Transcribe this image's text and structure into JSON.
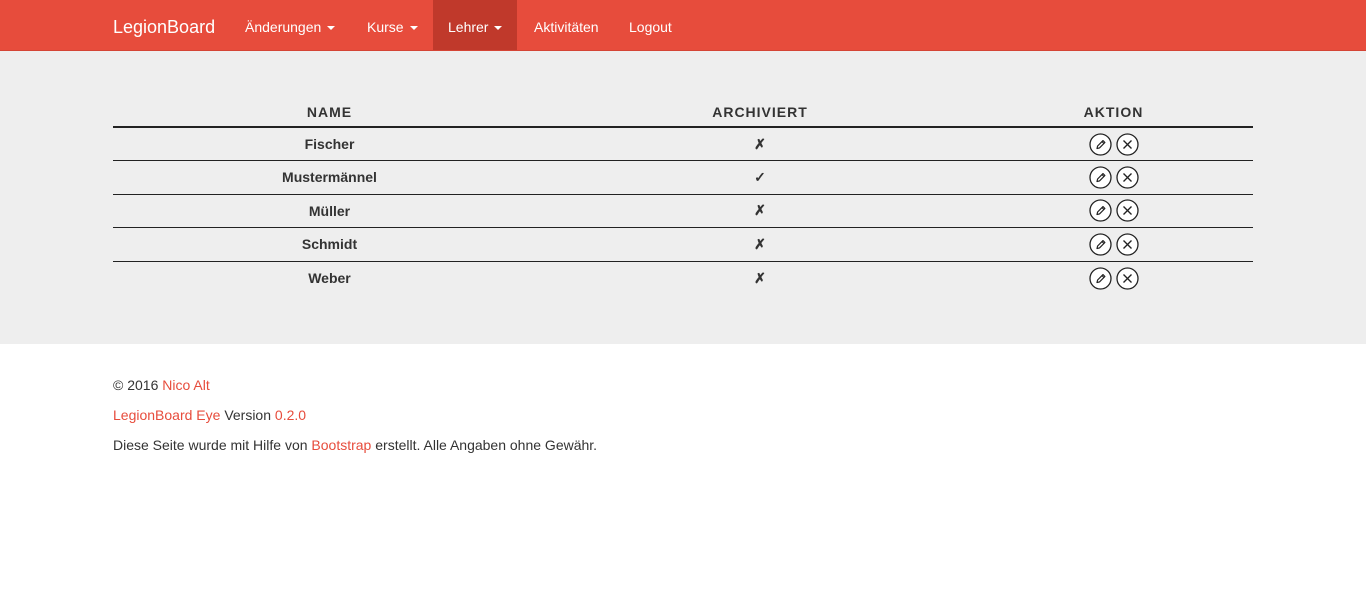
{
  "navbar": {
    "brand": "LegionBoard",
    "items": [
      {
        "label": "Änderungen",
        "dropdown": true,
        "active": false
      },
      {
        "label": "Kurse",
        "dropdown": true,
        "active": false
      },
      {
        "label": "Lehrer",
        "dropdown": true,
        "active": true
      },
      {
        "label": "Aktivitäten",
        "dropdown": false,
        "active": false
      },
      {
        "label": "Logout",
        "dropdown": false,
        "active": false
      }
    ]
  },
  "table": {
    "headers": {
      "name": "Name",
      "archived": "Archiviert",
      "action": "Aktion"
    },
    "rows": [
      {
        "name": "Fischer",
        "archived": "✗"
      },
      {
        "name": "Mustermännel",
        "archived": "✓"
      },
      {
        "name": "Müller",
        "archived": "✗"
      },
      {
        "name": "Schmidt",
        "archived": "✗"
      },
      {
        "name": "Weber",
        "archived": "✗"
      }
    ],
    "action_icons": [
      "pencil-icon",
      "close-circle-icon"
    ]
  },
  "footer": {
    "copyright_prefix": "© 2016",
    "author_link": "Nico Alt",
    "app_link": "LegionBoard Eye",
    "version_text": "Version",
    "version_link": "0.2.0",
    "credits_prefix": "Diese Seite wurde mit Hilfe von",
    "credits_link": "Bootstrap",
    "credits_suffix": "erstellt. Alle Angaben ohne Gewähr."
  },
  "colors": {
    "brand": "#e74c3c",
    "active_nav": "#c0392b",
    "jumbotron": "#eeeeee"
  }
}
